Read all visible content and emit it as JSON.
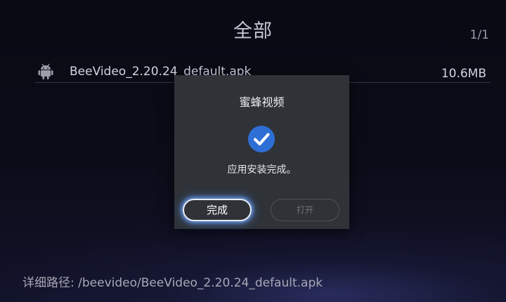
{
  "header": {
    "title": "全部",
    "page_indicator": "1/1"
  },
  "file_list": [
    {
      "icon": "android-icon",
      "name": "BeeVideo_2.20.24_default.apk",
      "size": "10.6MB"
    }
  ],
  "footer": {
    "path_text": "详细路径: /beevideo/BeeVideo_2.20.24_default.apk"
  },
  "dialog": {
    "title": "蜜蜂视频",
    "icon": "check-circle-icon",
    "message": "应用安装完成。",
    "done_button": "完成",
    "open_button": "打开"
  },
  "colors": {
    "accent": "#2e6fd6",
    "dialog_bg": "#2f3338",
    "focus_glow": "#78aaff"
  }
}
